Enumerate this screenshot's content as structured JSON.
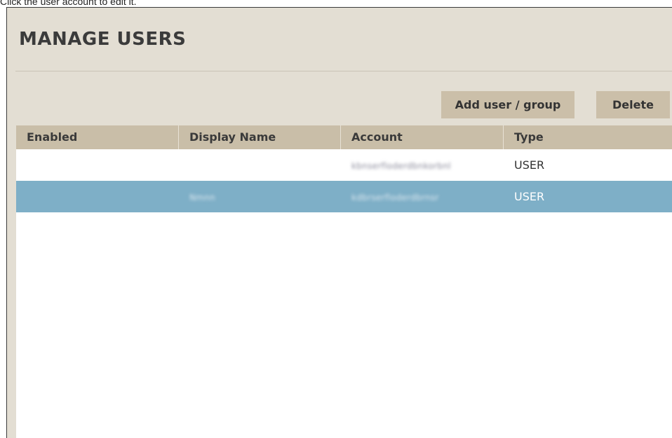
{
  "caption": "Click the user account to edit it.",
  "page": {
    "title": "MANAGE USERS"
  },
  "toolbar": {
    "add_label": "Add user / group",
    "delete_label": "Delete"
  },
  "table": {
    "columns": [
      "Enabled",
      "Display Name",
      "Account",
      "Type"
    ],
    "rows": [
      {
        "enabled": "",
        "display_name": "",
        "account": "kbnserfloderdbnkorbnl",
        "type": "USER",
        "selected": false
      },
      {
        "enabled": "",
        "display_name": "Nmnn",
        "account": "kdbrserfloderdbrnsr",
        "type": "USER",
        "selected": true
      }
    ]
  },
  "colors": {
    "panel_bg": "#e3ded3",
    "header_bg": "#c9bea8",
    "button_bg": "#cbbfa9",
    "selected_row": "#7eafc7"
  }
}
